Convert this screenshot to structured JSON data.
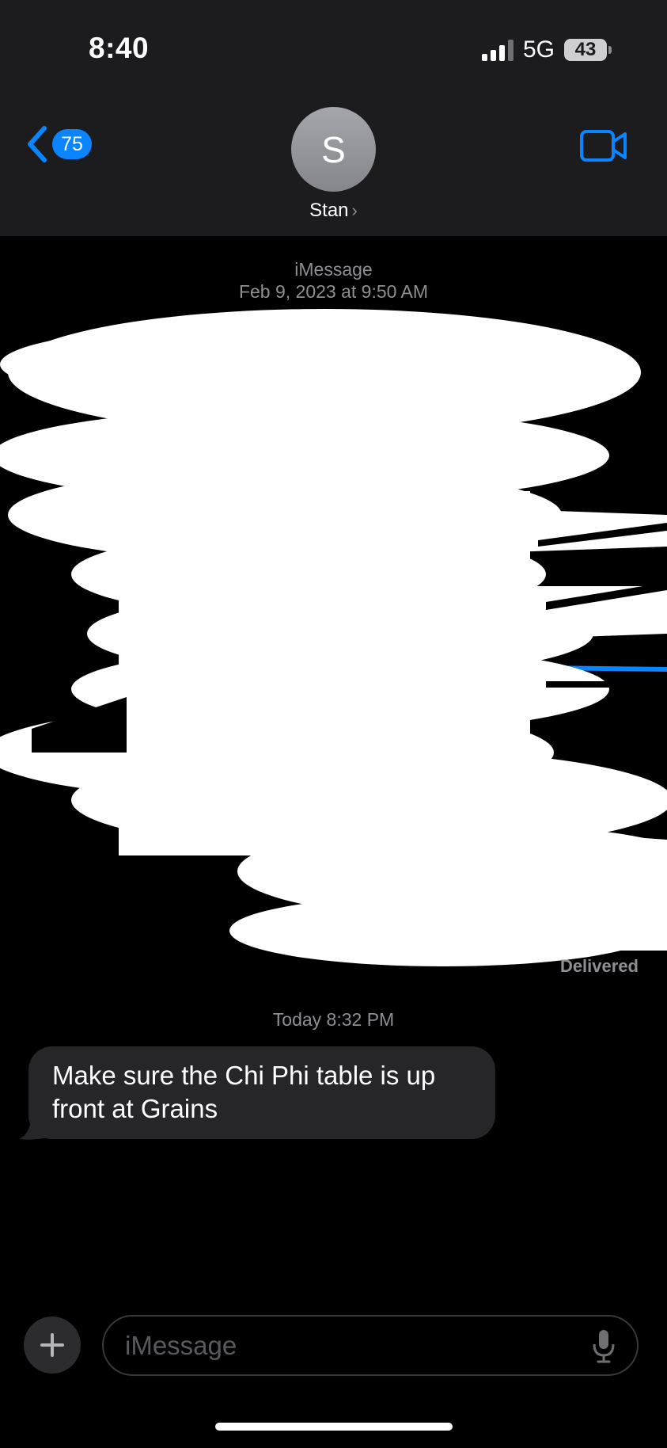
{
  "status_bar": {
    "time": "8:40",
    "network": "5G",
    "battery": "43"
  },
  "nav": {
    "back_count": "75",
    "avatar_initial": "S",
    "contact_name": "Stan",
    "chevron": "›"
  },
  "thread": {
    "service": "iMessage",
    "first_timestamp": "Feb 9, 2023 at 9:50 AM",
    "delivered": "Delivered",
    "today_timestamp": "Today 8:32 PM"
  },
  "messages": [
    {
      "direction": "incoming",
      "text": "Make sure the Chi Phi table is up front at Grains"
    }
  ],
  "composer": {
    "placeholder": "iMessage"
  },
  "colors": {
    "accent": "#0a84ff",
    "header_bg": "#1c1c1e",
    "incoming_bubble": "#262629",
    "background": "#000000"
  },
  "icons": {
    "back": "chevron-left-icon",
    "video": "video-camera-icon",
    "add": "plus-icon",
    "mic": "microphone-icon"
  }
}
